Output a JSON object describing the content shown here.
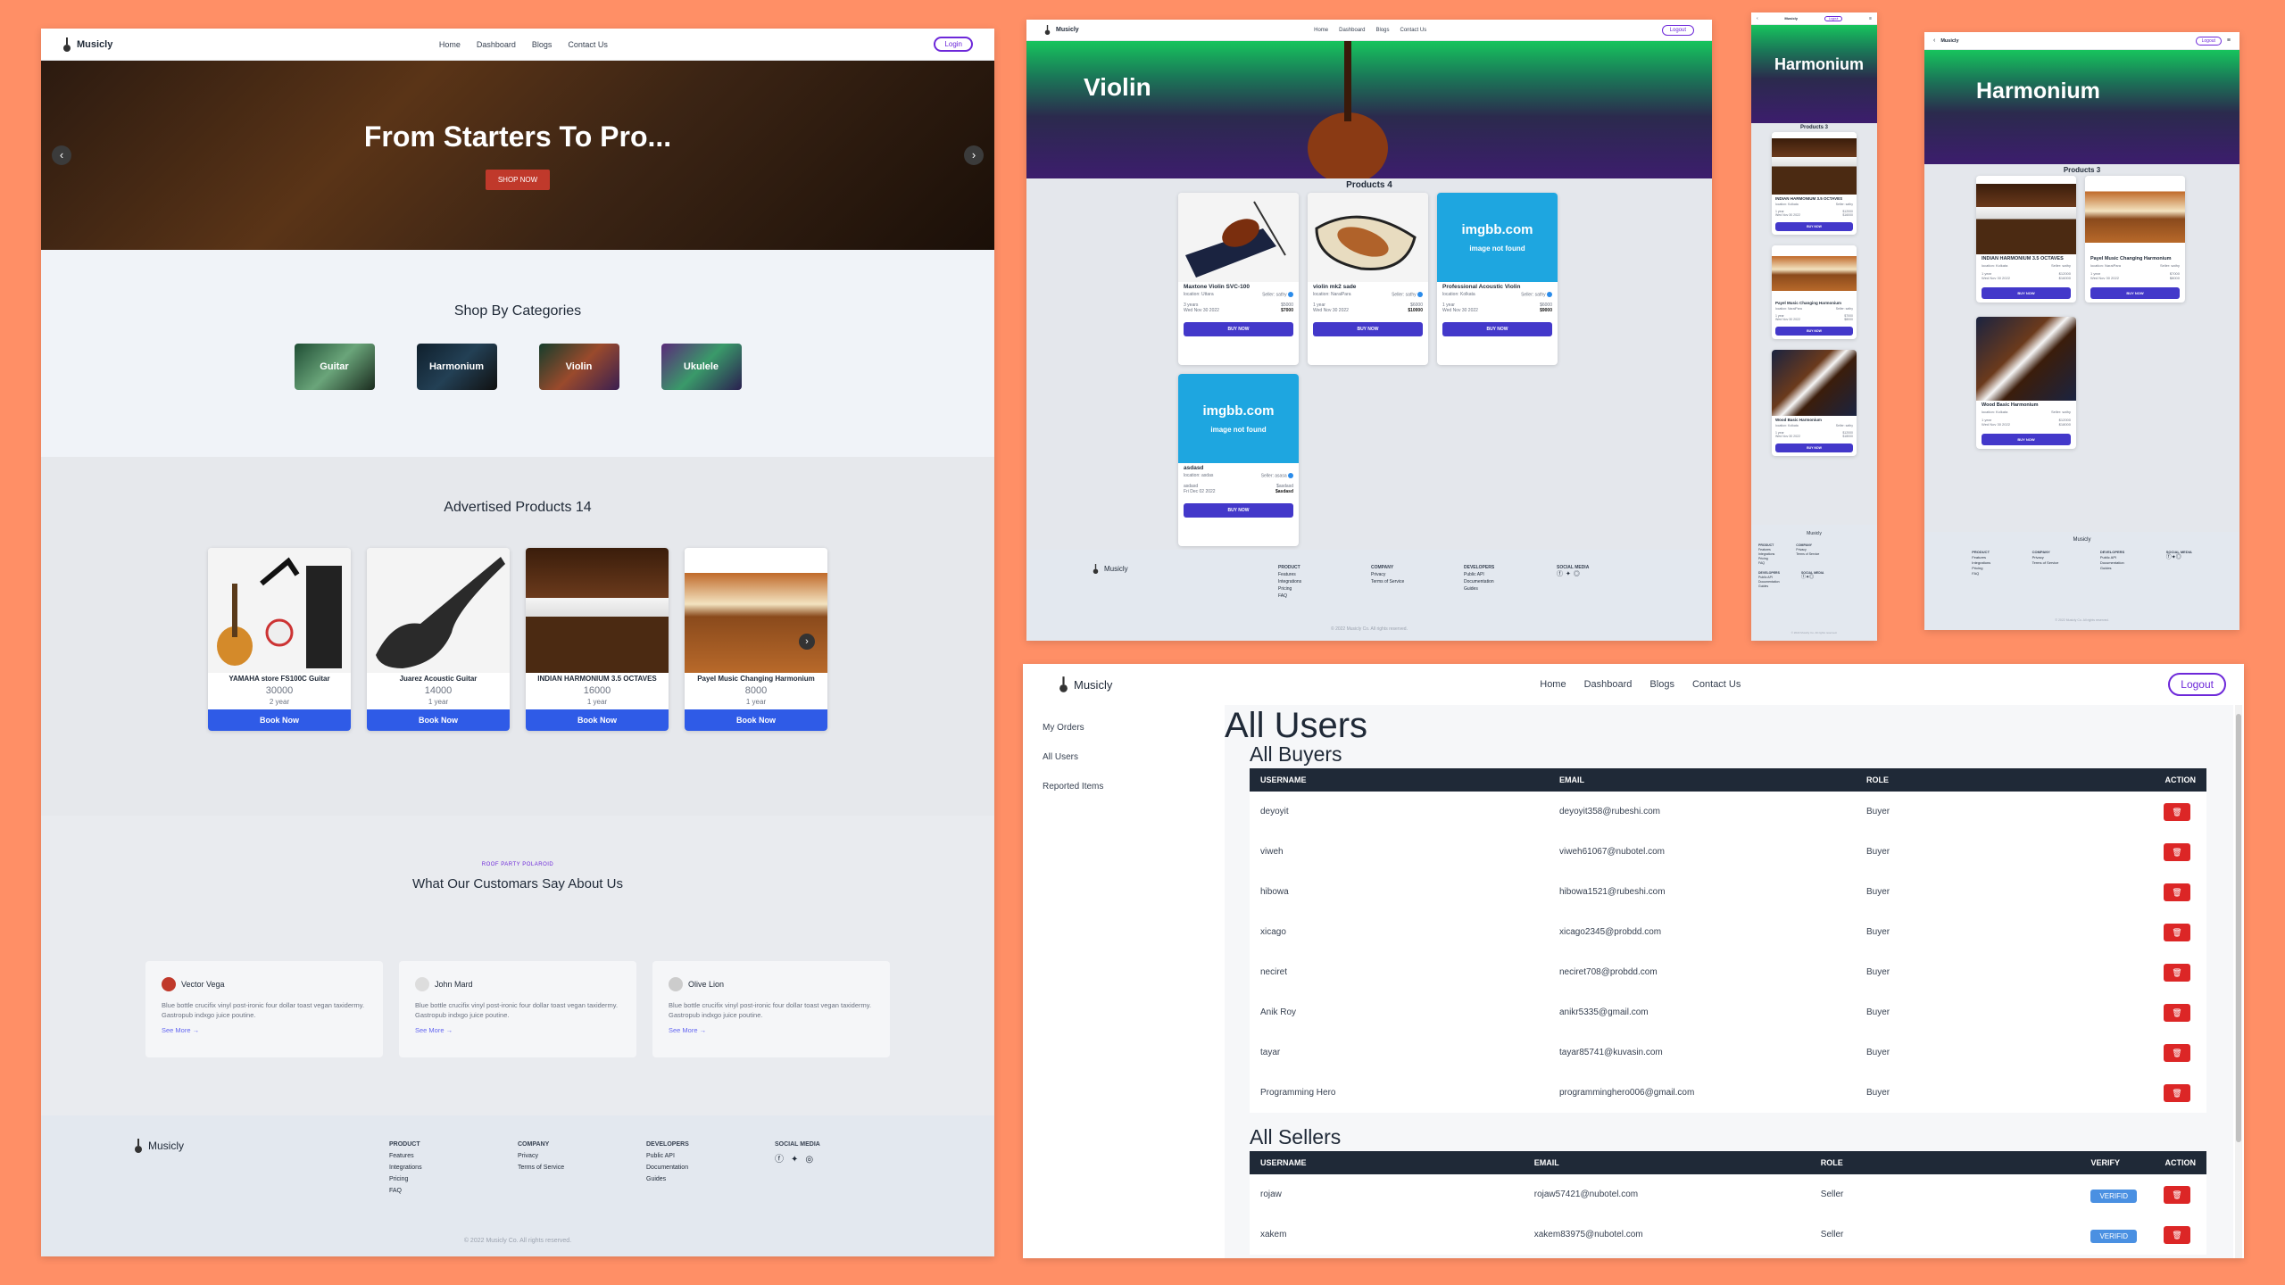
{
  "brand": "Musicly",
  "nav": {
    "home": "Home",
    "dashboard": "Dashboard",
    "blogs": "Blogs",
    "contact": "Contact Us",
    "login": "Login",
    "logout": "Logout"
  },
  "home": {
    "hero_title": "From Starters To Pro...",
    "hero_button": "SHOP NOW",
    "categories_title": "Shop By Categories",
    "categories": [
      "Guitar",
      "Harmonium",
      "Violin",
      "Ukulele"
    ],
    "advertised_title": "Advertised Products 14",
    "products": [
      {
        "name": "YAMAHA store FS100C Guitar",
        "price": "30000",
        "used": "2 year",
        "button": "Book Now"
      },
      {
        "name": "Juarez Acoustic Guitar",
        "price": "14000",
        "used": "1 year",
        "button": "Book Now"
      },
      {
        "name": "INDIAN HARMONIUM 3.5 OCTAVES",
        "price": "16000",
        "used": "1 year",
        "button": "Book Now"
      },
      {
        "name": "Payel Music Changing Harmonium",
        "price": "8000",
        "used": "1 year",
        "button": "Book Now"
      }
    ],
    "testimonial_kicker": "ROOF PARTY POLAROID",
    "testimonial_title": "What Our Customars Say About Us",
    "testimonials": [
      {
        "name": "Vector Vega",
        "text": "Blue bottle crucifix vinyl post-ironic four dollar toast vegan taxidermy. Gastropub indxgo juice poutine.",
        "link": "See More"
      },
      {
        "name": "John Mard",
        "text": "Blue bottle crucifix vinyl post-ironic four dollar toast vegan taxidermy. Gastropub indxgo juice poutine.",
        "link": "See More"
      },
      {
        "name": "Olive Lion",
        "text": "Blue bottle crucifix vinyl post-ironic four dollar toast vegan taxidermy. Gastropub indxgo juice poutine.",
        "link": "See More"
      }
    ]
  },
  "footer": {
    "product_h": "PRODUCT",
    "product": [
      "Features",
      "Integrations",
      "Pricing",
      "FAQ"
    ],
    "company_h": "COMPANY",
    "company": [
      "Privacy",
      "Terms of Service"
    ],
    "developers_h": "DEVELOPERS",
    "developers": [
      "Public API",
      "Documentation",
      "Guides"
    ],
    "social_h": "SOCIAL MEDIA",
    "copyright": "© 2022 Musicly Co. All rights reserved."
  },
  "violin": {
    "title": "Violin",
    "count": "Products 4",
    "items": [
      {
        "name": "Maxtone Violin SVC-100",
        "location": "location: Uttara",
        "seller": "Seller: sathy",
        "used": "3 years",
        "date": "Wed Nov 30 2022",
        "price1": "$5000",
        "price2": "$7000",
        "button": "BUY NOW"
      },
      {
        "name": "violin mk2 sade",
        "location": "location: NaraiPara",
        "seller": "Seller: sathy",
        "used": "1 year",
        "date": "Wed Nov 30 2022",
        "price1": "$6000",
        "price2": "$10000",
        "button": "BUY NOW"
      },
      {
        "name": "Professional Acoustic Violin",
        "location": "location: Kolkata",
        "seller": "Seller: sathy",
        "used": "1 year",
        "date": "Wed Nov 30 2022",
        "price1": "$6000",
        "price2": "$9000",
        "button": "BUY NOW"
      },
      {
        "name": "asdasd",
        "location": "location: asdas",
        "seller": "Seller: asasa",
        "used": "asdasd",
        "date": "Fri Dec 02 2022",
        "price1": "$asdasd",
        "price2": "$asdasd",
        "button": "BUY NOW"
      }
    ],
    "imgbb_1": "imgbb.com",
    "imgbb_2": "image not found"
  },
  "harmonium": {
    "title": "Harmonium",
    "count": "Products 3",
    "items": [
      {
        "name": "INDIAN HARMONIUM 3.5 OCTAVES",
        "location": "location: Kolkata",
        "seller": "Seller: sathy",
        "used": "1 year",
        "date": "Wed Nov 30 2022",
        "price1": "$12000",
        "price2": "$16000",
        "button": "BUY NOW"
      },
      {
        "name": "Payel Music Changing Harmonium",
        "location": "location: NaraiPara",
        "seller": "Seller: sathy",
        "used": "1 year",
        "date": "Wed Nov 30 2022",
        "price1": "$7000",
        "price2": "$8000",
        "button": "BUY NOW"
      },
      {
        "name": "Wood Basic Harmonium",
        "location": "location: Kolkata",
        "seller": "Seller: sathy",
        "used": "1 year",
        "date": "Wed Nov 30 2022",
        "price1": "$12000",
        "price2": "$18000",
        "button": "BUY NOW"
      }
    ]
  },
  "dashboard": {
    "menu": [
      "My Orders",
      "All Users",
      "Reported Items"
    ],
    "title": "All Users",
    "buyers_title": "All Buyers",
    "buyers_cols": [
      "USERNAME",
      "EMAIL",
      "ROLE",
      "ACTION"
    ],
    "buyers": [
      {
        "u": "deyoyit",
        "e": "deyoyit358@rubeshi.com",
        "r": "Buyer"
      },
      {
        "u": "viweh",
        "e": "viweh61067@nubotel.com",
        "r": "Buyer"
      },
      {
        "u": "hibowa",
        "e": "hibowa1521@rubeshi.com",
        "r": "Buyer"
      },
      {
        "u": "xicago",
        "e": "xicago2345@probdd.com",
        "r": "Buyer"
      },
      {
        "u": "neciret",
        "e": "neciret708@probdd.com",
        "r": "Buyer"
      },
      {
        "u": "Anik Roy",
        "e": "anikr5335@gmail.com",
        "r": "Buyer"
      },
      {
        "u": "tayar",
        "e": "tayar85741@kuvasin.com",
        "r": "Buyer"
      },
      {
        "u": "Programming Hero",
        "e": "programminghero006@gmail.com",
        "r": "Buyer"
      }
    ],
    "sellers_title": "All Sellers",
    "sellers_cols": [
      "USERNAME",
      "EMAIL",
      "ROLE",
      "VERIFY",
      "ACTION"
    ],
    "sellers": [
      {
        "u": "rojaw",
        "e": "rojaw57421@nubotel.com",
        "r": "Seller",
        "v": "VERIFID"
      },
      {
        "u": "xakem",
        "e": "xakem83975@nubotel.com",
        "r": "Seller",
        "v": "VERIFID"
      }
    ]
  }
}
